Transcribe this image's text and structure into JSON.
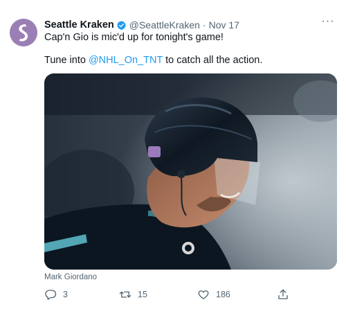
{
  "tweet": {
    "display_name": "Seattle Kraken",
    "handle": "@SeattleKraken",
    "separator": "·",
    "date": "Nov 17",
    "more_label": "···",
    "text_line1": "Cap'n Gio is mic'd up for tonight's game!",
    "text_line2_before": "Tune into ",
    "mention": "@NHL_On_TNT",
    "text_line2_after": " to catch all the action.",
    "media_caption": "Mark Giordano",
    "actions": {
      "reply_count": "3",
      "retweet_count": "15",
      "like_count": "186"
    }
  },
  "colors": {
    "accent": "#1d9bf0",
    "avatar_bg": "#9a7fb5",
    "secondary_text": "#536471"
  },
  "icons": {
    "avatar": "kraken-logo",
    "verified": "verified-badge-icon",
    "more": "more-icon",
    "reply": "reply-icon",
    "retweet": "retweet-icon",
    "like": "like-icon",
    "share": "share-icon"
  }
}
